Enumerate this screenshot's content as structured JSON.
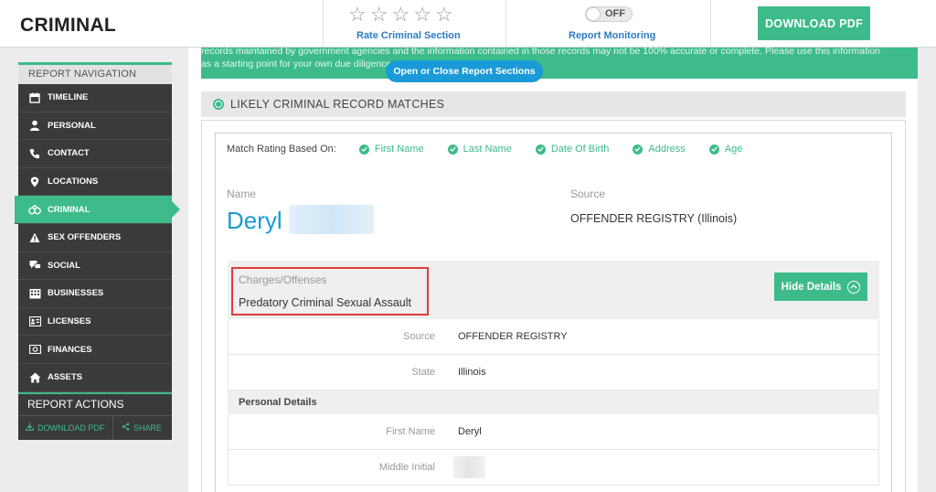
{
  "header": {
    "title": "CRIMINAL",
    "stars": [
      "☆",
      "☆",
      "☆",
      "☆",
      "☆"
    ],
    "rate_link": "Rate Criminal Section",
    "toggle_state": "OFF",
    "monitoring_link": "Report Monitoring",
    "download_button": "DOWNLOAD PDF"
  },
  "sidebar": {
    "nav_header": "REPORT NAVIGATION",
    "items": [
      {
        "label": "TIMELINE",
        "icon": "calendar-icon"
      },
      {
        "label": "PERSONAL",
        "icon": "person-icon"
      },
      {
        "label": "CONTACT",
        "icon": "phone-icon"
      },
      {
        "label": "LOCATIONS",
        "icon": "map-pin-icon"
      },
      {
        "label": "CRIMINAL",
        "icon": "handcuffs-icon",
        "active": true
      },
      {
        "label": "SEX OFFENDERS",
        "icon": "warning-icon"
      },
      {
        "label": "SOCIAL",
        "icon": "chat-icon"
      },
      {
        "label": "BUSINESSES",
        "icon": "building-icon"
      },
      {
        "label": "LICENSES",
        "icon": "id-card-icon"
      },
      {
        "label": "FINANCES",
        "icon": "money-icon"
      },
      {
        "label": "ASSETS",
        "icon": "house-icon"
      }
    ],
    "actions_header": "REPORT ACTIONS",
    "action_download": "DOWNLOAD PDF",
    "action_share": "SHARE"
  },
  "main": {
    "banner_line1": "records maintained by government agencies and the information contained in those records may not be 100% accurate or complete. Please use this information",
    "banner_line2": "as a starting point for your own due diligence.",
    "sections_button": "Open or Close Report Sections",
    "section_title": "LIKELY CRIMINAL RECORD MATCHES",
    "match_label": "Match Rating Based On:",
    "match_criteria": [
      "First Name",
      "Last Name",
      "Date Of Birth",
      "Address",
      "Age"
    ],
    "name_label": "Name",
    "name_value": "Deryl",
    "source_label": "Source",
    "source_value": "OFFENDER REGISTRY (Illinois)",
    "charges_label": "Charges/Offenses",
    "charges_value": "Predatory Criminal Sexual Assault",
    "hide_details": "Hide Details",
    "details": [
      {
        "key": "Source",
        "value": "OFFENDER REGISTRY"
      },
      {
        "key": "State",
        "value": "Illinois"
      }
    ],
    "personal_details_header": "Personal Details",
    "personal": [
      {
        "key": "First Name",
        "value": "Deryl"
      },
      {
        "key": "Middle Initial",
        "value": ""
      }
    ]
  },
  "colors": {
    "accent_green": "#3dbb8a",
    "link_blue": "#2c7cc1",
    "button_blue": "#1a9ad6",
    "sidebar_dark": "#3a3a3a",
    "highlight_red": "#e03c3c"
  }
}
